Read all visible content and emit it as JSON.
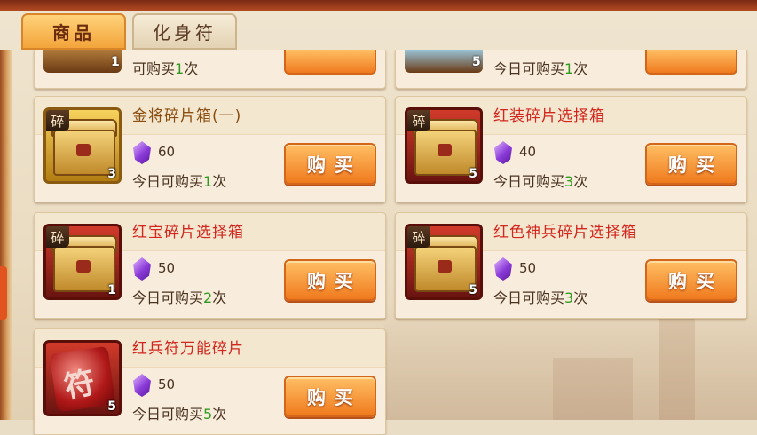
{
  "tabs": [
    {
      "label": "商品",
      "active": true
    },
    {
      "label": "化身符",
      "active": false
    }
  ],
  "partial_row": [
    {
      "limit_prefix": "可购买",
      "limit_count": "1",
      "limit_suffix": "次",
      "count": "1"
    },
    {
      "limit_prefix": "今日可购买",
      "limit_count": "1",
      "limit_suffix": "次",
      "count": "5"
    }
  ],
  "items": [
    {
      "name": "金将碎片箱(一)",
      "name_color": "gold",
      "frame": "gold",
      "icon": "hero-chest-icon",
      "fragment_tag": "碎",
      "count": "3",
      "price": "60",
      "limit_prefix": "今日可购买",
      "limit_count": "1",
      "limit_suffix": "次",
      "button": "购买"
    },
    {
      "name": "红装碎片选择箱",
      "name_color": "red",
      "frame": "red",
      "icon": "equipment-chest-icon",
      "fragment_tag": "碎",
      "count": "5",
      "price": "40",
      "limit_prefix": "今日可购买",
      "limit_count": "3",
      "limit_suffix": "次",
      "button": "购买"
    },
    {
      "name": "红宝碎片选择箱",
      "name_color": "red",
      "frame": "red",
      "icon": "gem-chest-icon",
      "fragment_tag": "碎",
      "count": "1",
      "price": "50",
      "limit_prefix": "今日可购买",
      "limit_count": "2",
      "limit_suffix": "次",
      "button": "购买"
    },
    {
      "name": "红色神兵碎片选择箱",
      "name_color": "red",
      "frame": "red",
      "icon": "weapon-chest-icon",
      "fragment_tag": "碎",
      "count": "5",
      "price": "50",
      "limit_prefix": "今日可购买",
      "limit_count": "3",
      "limit_suffix": "次",
      "button": "购买"
    },
    {
      "name": "红兵符万能碎片",
      "name_color": "red",
      "frame": "red",
      "icon": "token-fragment-icon",
      "fragment_tag": "",
      "token_glyph": "符",
      "count": "5",
      "price": "50",
      "limit_prefix": "今日可购买",
      "limit_count": "5",
      "limit_suffix": "次",
      "button": "购买"
    }
  ],
  "currency_icon": "purple-gem-icon",
  "colors": {
    "accent": "#f07a1e",
    "name_red": "#d2261e",
    "name_gold": "#8a4e12",
    "count_green": "#2f9a1e"
  }
}
